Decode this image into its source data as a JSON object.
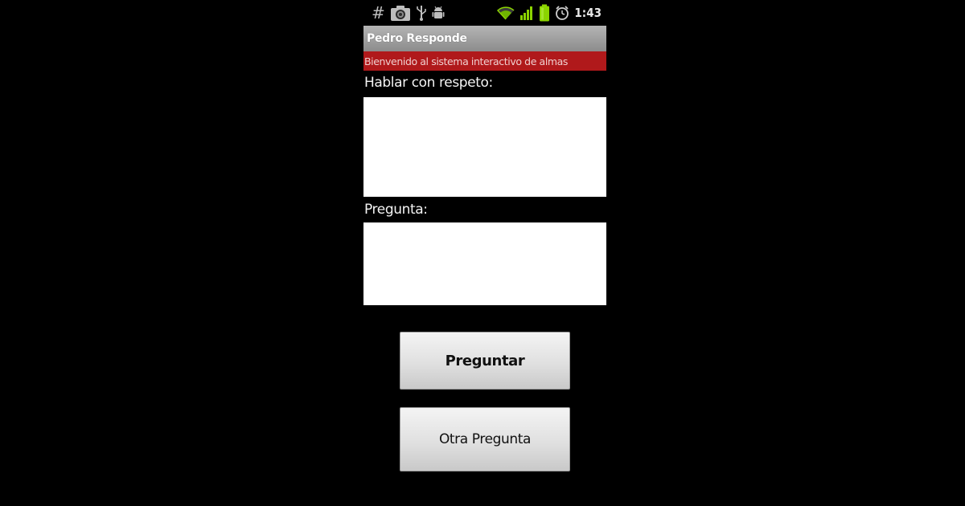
{
  "status_bar": {
    "left_icons": [
      "hash-icon",
      "camera-icon",
      "usb-icon",
      "android-debug-icon"
    ],
    "right_icons": [
      "wifi-icon",
      "signal-icon",
      "battery-icon",
      "alarm-clock-icon"
    ],
    "hash_glyph": "#",
    "time": "1:43",
    "battery_color": "#8bd400",
    "signal_color": "#8bd400",
    "wifi_color": "#8bd400"
  },
  "app": {
    "title": "Pedro Responde",
    "welcome_banner": "Bienvenido al sistema interactivo de almas",
    "banner_color": "#b0191b"
  },
  "form": {
    "respect_label": "Hablar con respeto:",
    "respect_value": "",
    "question_label": "Pregunta:",
    "question_value": ""
  },
  "buttons": {
    "ask_label": "Preguntar",
    "another_label": "Otra Pregunta"
  }
}
